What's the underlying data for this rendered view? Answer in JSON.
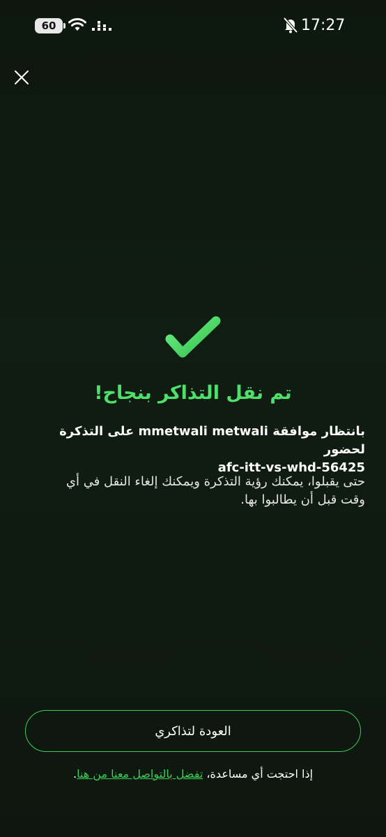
{
  "status_bar": {
    "battery": "60",
    "time": "17:27",
    "icons": [
      "wifi-icon",
      "signal-icon",
      "mute-bell-icon"
    ]
  },
  "header": {
    "close_icon": "close-icon"
  },
  "success": {
    "icon": "checkmark-icon",
    "accent_color": "#4ee06a",
    "title": "تم نقل التذاكر بنجاح!",
    "message_line1": "بانتظار موافقة  mmetwali metwali على التذكرة لحضور",
    "message_line2": "afc-itt-vs-whd-56425",
    "hint_line1": "حتى يقبلوا، يمكنك رؤية التذكرة ويمكنك إلغاء النقل في أي",
    "hint_line2": "وقت قبل أن يطالبوا بها."
  },
  "footer": {
    "back_button_label": "العودة لتذاكري",
    "help_prefix": "إذا احتجت أي مساعدة، ",
    "help_link": "تفضل بالتواصل معنا من هنا",
    "help_suffix": "."
  }
}
